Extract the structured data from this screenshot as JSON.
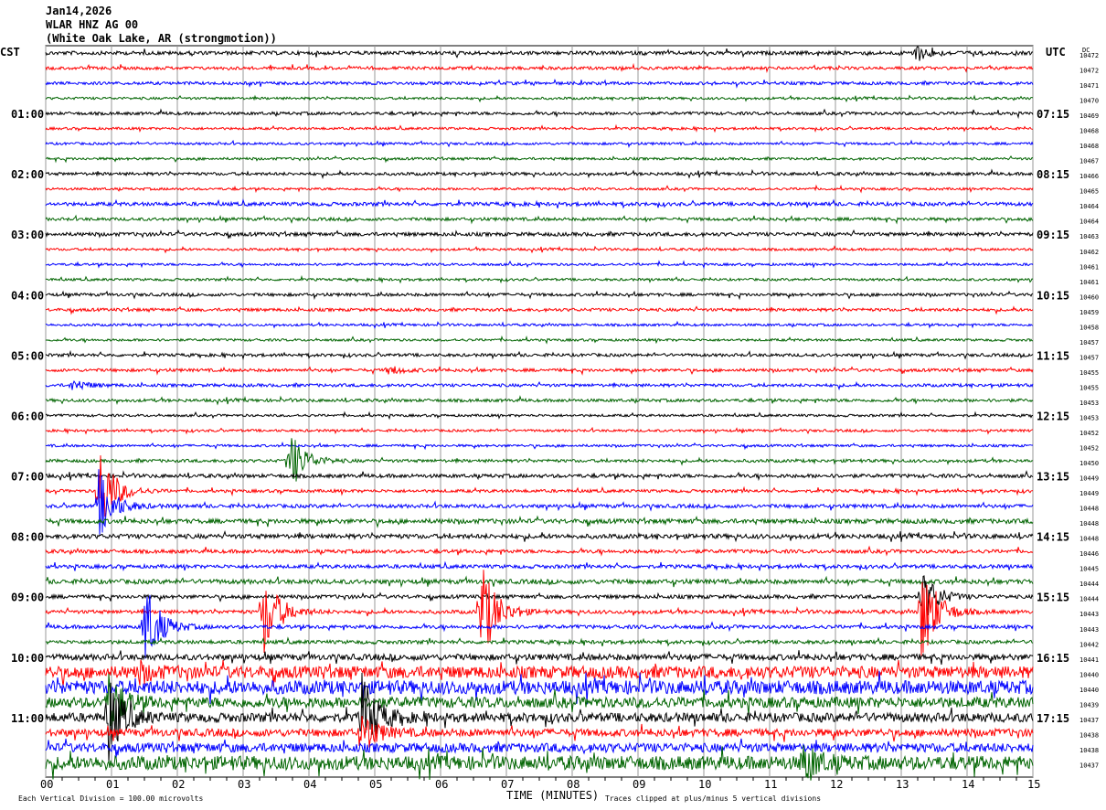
{
  "header": {
    "date": "Jan14,2026",
    "station": "WLAR HNZ AG 00",
    "location": "(White Oak Lake, AR (strongmotion))"
  },
  "left_tz": "CST",
  "right_tz": "UTC",
  "dc_label": "DC",
  "footer": {
    "scale": "Each Vertical Division =  100.00 microvolts",
    "xlabel": "TIME (MINUTES)",
    "clip": "Traces clipped at plus/minus 5 vertical divisions"
  },
  "chart_data": {
    "type": "line",
    "xlabel": "TIME (MINUTES)",
    "xlim": [
      0,
      15
    ],
    "xticks": [
      "00",
      "01",
      "02",
      "03",
      "04",
      "05",
      "06",
      "07",
      "08",
      "09",
      "10",
      "11",
      "12",
      "13",
      "14",
      "15"
    ],
    "grid": true,
    "trace_colors": [
      "#000000",
      "#ff0000",
      "#0000ff",
      "#006400"
    ],
    "left_labels": [
      "",
      "01:00",
      "02:00",
      "03:00",
      "04:00",
      "05:00",
      "06:00",
      "07:00",
      "08:00",
      "09:00",
      "10:00",
      "11:00"
    ],
    "right_labels": [
      "",
      "07:15",
      "08:15",
      "09:15",
      "10:15",
      "11:15",
      "12:15",
      "13:15",
      "14:15",
      "15:15",
      "16:15",
      "17:15"
    ],
    "dc_values": [
      10472,
      10472,
      10471,
      10470,
      10469,
      10468,
      10468,
      10467,
      10466,
      10465,
      10464,
      10464,
      10463,
      10462,
      10461,
      10461,
      10460,
      10459,
      10458,
      10457,
      10457,
      10455,
      10455,
      10453,
      10453,
      10452,
      10452,
      10450,
      10449,
      10449,
      10448,
      10448,
      10448,
      10446,
      10445,
      10444,
      10444,
      10443,
      10443,
      10442,
      10441,
      10440,
      10440,
      10439,
      10437,
      10438,
      10438,
      10437
    ],
    "noise_divisions": [
      0.12,
      0.1,
      0.1,
      0.08,
      0.1,
      0.08,
      0.08,
      0.08,
      0.1,
      0.08,
      0.12,
      0.1,
      0.12,
      0.08,
      0.08,
      0.08,
      0.1,
      0.1,
      0.08,
      0.08,
      0.1,
      0.1,
      0.1,
      0.1,
      0.08,
      0.08,
      0.08,
      0.1,
      0.12,
      0.1,
      0.12,
      0.15,
      0.15,
      0.12,
      0.12,
      0.15,
      0.12,
      0.12,
      0.12,
      0.12,
      0.2,
      0.4,
      0.45,
      0.35,
      0.3,
      0.25,
      0.3,
      0.45
    ],
    "events": [
      {
        "trace": 0,
        "minute": 13.2,
        "amp": 0.6
      },
      {
        "trace": 22,
        "minute": 0.4,
        "amp": 0.4
      },
      {
        "trace": 21,
        "minute": 5.2,
        "amp": 0.3
      },
      {
        "trace": 29,
        "minute": 0.8,
        "amp": 3.5
      },
      {
        "trace": 30,
        "minute": 0.8,
        "amp": 2.5
      },
      {
        "trace": 27,
        "minute": 3.7,
        "amp": 2.2
      },
      {
        "trace": 37,
        "minute": 3.3,
        "amp": 3.2
      },
      {
        "trace": 37,
        "minute": 6.6,
        "amp": 4
      },
      {
        "trace": 37,
        "minute": 13.3,
        "amp": 4
      },
      {
        "trace": 36,
        "minute": 13.3,
        "amp": 2
      },
      {
        "trace": 38,
        "minute": 1.5,
        "amp": 3.2
      },
      {
        "trace": 41,
        "minute": 1.4,
        "amp": 0.6
      },
      {
        "trace": 44,
        "minute": 0.95,
        "amp": 3
      },
      {
        "trace": 44,
        "minute": 4.8,
        "amp": 3
      },
      {
        "trace": 43,
        "minute": 0.95,
        "amp": 2
      },
      {
        "trace": 45,
        "minute": 4.8,
        "amp": 1.5
      },
      {
        "trace": 47,
        "minute": 11.5,
        "amp": 1.5
      }
    ]
  }
}
